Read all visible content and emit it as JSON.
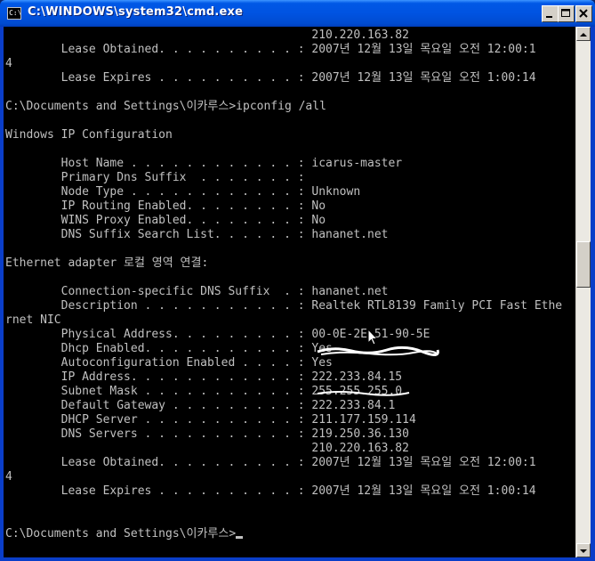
{
  "window": {
    "title": "C:\\WINDOWS\\system32\\cmd.exe",
    "icon_text": "C:\\",
    "icon": "console-icon",
    "buttons": {
      "minimize": "minimize-icon",
      "maximize": "maximize-icon",
      "close": "close-icon"
    }
  },
  "colors": {
    "titlebar": "#0054e3",
    "console_bg": "#000000",
    "console_text": "#c0c0c0"
  },
  "console": {
    "lines": [
      "                                            210.220.163.82",
      "        Lease Obtained. . . . . . . . . . : 2007년 12월 13일 목요일 오전 12:00:1",
      "4",
      "        Lease Expires . . . . . . . . . . : 2007년 12월 13일 목요일 오전 1:00:14",
      "",
      "C:\\Documents and Settings\\이카루스>ipconfig /all",
      "",
      "Windows IP Configuration",
      "",
      "        Host Name . . . . . . . . . . . . : icarus-master",
      "        Primary Dns Suffix  . . . . . . . :",
      "        Node Type . . . . . . . . . . . . : Unknown",
      "        IP Routing Enabled. . . . . . . . : No",
      "        WINS Proxy Enabled. . . . . . . . : No",
      "        DNS Suffix Search List. . . . . . : hananet.net",
      "",
      "Ethernet adapter 로컬 영역 연결:",
      "",
      "        Connection-specific DNS Suffix  . : hananet.net",
      "        Description . . . . . . . . . . . : Realtek RTL8139 Family PCI Fast Ethe",
      "rnet NIC",
      "        Physical Address. . . . . . . . . : 00-0E-2E-51-90-5E",
      "        Dhcp Enabled. . . . . . . . . . . : Yes",
      "        Autoconfiguration Enabled . . . . : Yes",
      "        IP Address. . . . . . . . . . . . : 222.233.84.15",
      "        Subnet Mask . . . . . . . . . . . : 255.255.255.0",
      "        Default Gateway . . . . . . . . . : 222.233.84.1",
      "        DHCP Server . . . . . . . . . . . : 211.177.159.114",
      "        DNS Servers . . . . . . . . . . . : 219.250.36.130",
      "                                            210.220.163.82",
      "        Lease Obtained. . . . . . . . . . : 2007년 12월 13일 목요일 오전 12:00:1",
      "4",
      "        Lease Expires . . . . . . . . . . : 2007년 12월 13일 목요일 오전 1:00:14",
      "",
      "",
      "C:\\Documents and Settings\\이카루스>"
    ]
  }
}
